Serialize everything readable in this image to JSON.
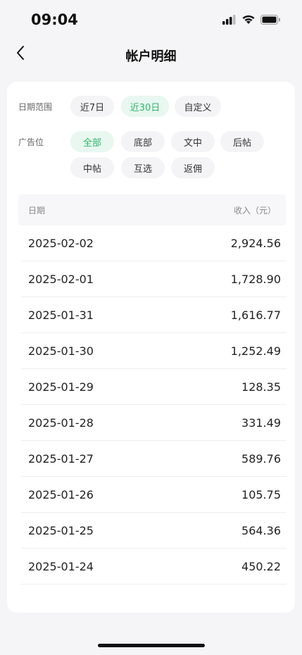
{
  "status_bar": {
    "time": "09:04"
  },
  "nav": {
    "title": "帐户明细"
  },
  "filters": {
    "date_range_label": "日期范围",
    "date_options": [
      {
        "label": "近7日",
        "active": false
      },
      {
        "label": "近30日",
        "active": true
      },
      {
        "label": "自定义",
        "active": false
      }
    ],
    "ad_slot_label": "广告位",
    "ad_slot_options": [
      {
        "label": "全部",
        "active": true
      },
      {
        "label": "底部",
        "active": false
      },
      {
        "label": "文中",
        "active": false
      },
      {
        "label": "后帖",
        "active": false
      },
      {
        "label": "中帖",
        "active": false
      },
      {
        "label": "互选",
        "active": false
      },
      {
        "label": "返佣",
        "active": false
      }
    ]
  },
  "table": {
    "headers": {
      "date": "日期",
      "income": "收入（元）"
    },
    "rows": [
      {
        "date": "2025-02-02",
        "amount": "2,924.56"
      },
      {
        "date": "2025-02-01",
        "amount": "1,728.90"
      },
      {
        "date": "2025-01-31",
        "amount": "1,616.77"
      },
      {
        "date": "2025-01-30",
        "amount": "1,252.49"
      },
      {
        "date": "2025-01-29",
        "amount": "128.35"
      },
      {
        "date": "2025-01-28",
        "amount": "331.49"
      },
      {
        "date": "2025-01-27",
        "amount": "589.76"
      },
      {
        "date": "2025-01-26",
        "amount": "105.75"
      },
      {
        "date": "2025-01-25",
        "amount": "564.36"
      },
      {
        "date": "2025-01-24",
        "amount": "450.22"
      }
    ]
  },
  "colors": {
    "accent": "#2fb56c",
    "accent_bg": "#e8f7ef"
  }
}
